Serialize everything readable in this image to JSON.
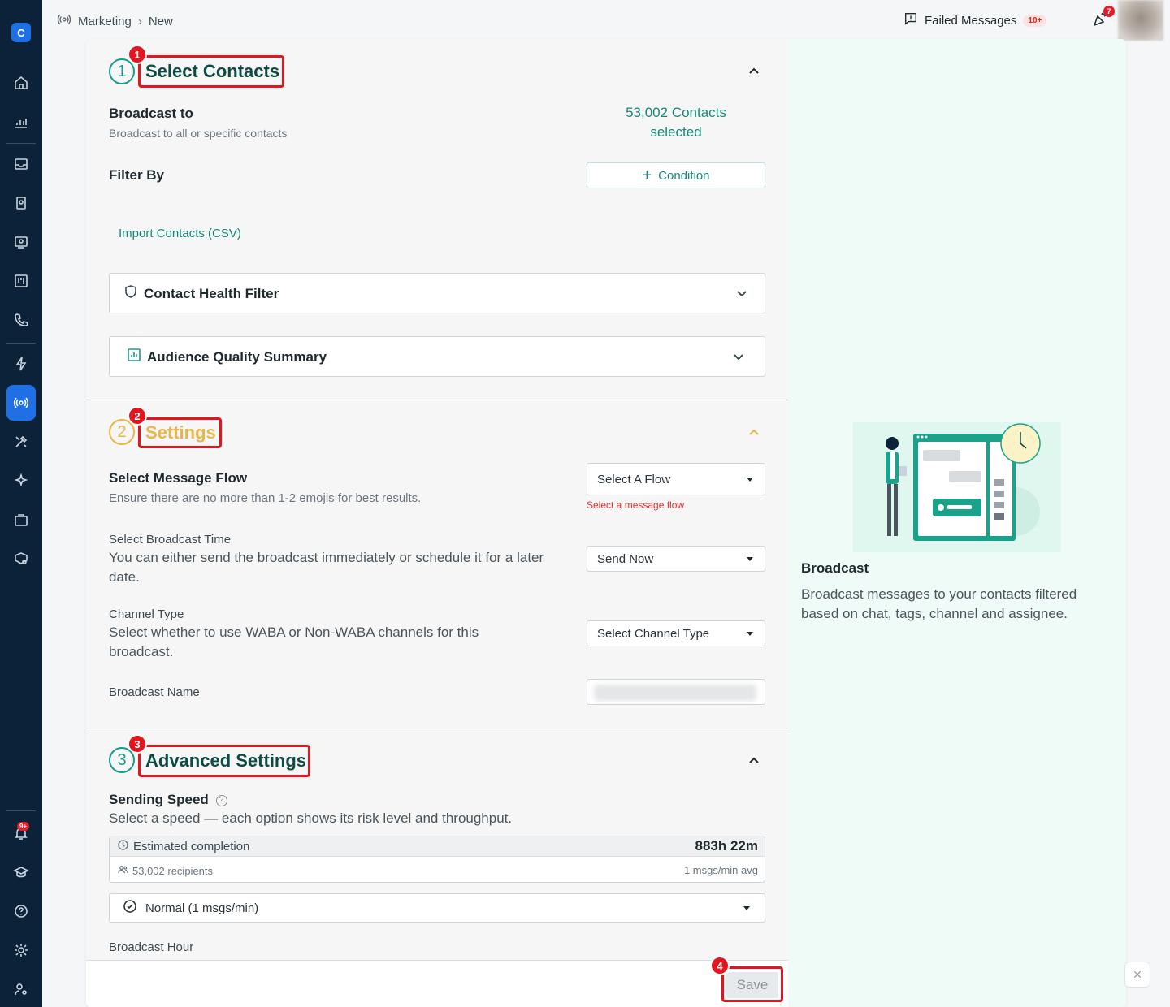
{
  "breadcrumb": {
    "root": "Marketing",
    "current": "New"
  },
  "topbar": {
    "failed_label": "Failed Messages",
    "failed_badge": "10+",
    "notif_badge": "7"
  },
  "sidebar": {
    "logo": "C",
    "notif_badge": "9+"
  },
  "section1": {
    "number": "1",
    "title": "Select Contacts",
    "marker": "1",
    "broadcast_to_label": "Broadcast to",
    "broadcast_to_sub": "Broadcast to all or specific contacts",
    "contacts_selected_line1": "53,002 Contacts",
    "contacts_selected_line2": "selected",
    "filter_by_label": "Filter By",
    "condition_button": "Condition",
    "import_link": "Import Contacts (CSV)",
    "health_filter": "Contact Health Filter",
    "audience_summary": "Audience Quality Summary"
  },
  "section2": {
    "number": "2",
    "title": "Settings",
    "marker": "2",
    "flow_label": "Select Message Flow",
    "flow_sub": "Ensure there are no more than 1-2 emojis for best results.",
    "flow_select": "Select A Flow",
    "flow_error": "Select a message flow",
    "time_label": "Select Broadcast Time",
    "time_desc": "You can either send the broadcast immediately or schedule it for a later date.",
    "time_select": "Send Now",
    "channel_label": "Channel Type",
    "channel_desc": "Select whether to use WABA or Non-WABA channels for this broadcast.",
    "channel_select": "Select Channel Type",
    "name_label": "Broadcast Name"
  },
  "section3": {
    "number": "3",
    "title": "Advanced Settings",
    "marker": "3",
    "speed_label": "Sending Speed",
    "speed_desc": "Select a speed — each option shows its risk level and throughput.",
    "est_label": "Estimated completion",
    "est_value": "883h 22m",
    "recipients": "53,002 recipients",
    "rate": "1 msgs/min avg",
    "speed_select": "Normal (1 msgs/min)",
    "hour_label": "Broadcast Hour"
  },
  "footer": {
    "save_label": "Save",
    "marker": "4"
  },
  "right_panel": {
    "title": "Broadcast",
    "description": "Broadcast messages to your contacts filtered based on chat, tags, channel and assignee."
  },
  "colors": {
    "teal": "#138a78",
    "orange": "#e8b649",
    "highlight": "#e1161f",
    "sidebar": "#0b2239",
    "accent_blue": "#1f6fe5"
  }
}
